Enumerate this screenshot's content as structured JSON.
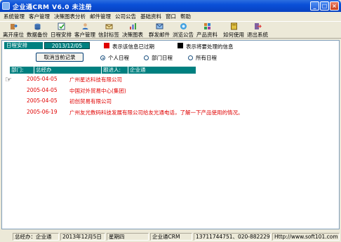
{
  "window": {
    "title": "企业通CRM V6.0   未注册"
  },
  "menu": [
    "系统管理",
    "客户管理",
    "决策图表分析",
    "邮件管理",
    "公司公告",
    "基础资料",
    "窗口",
    "帮助"
  ],
  "toolbar": [
    {
      "label": "离开座位",
      "icon": "exit-seat-icon"
    },
    {
      "label": "数据备份",
      "icon": "backup-icon"
    },
    {
      "label": "日程安排",
      "icon": "schedule-icon"
    },
    {
      "label": "客户管理",
      "icon": "customer-icon"
    },
    {
      "label": "信封标签",
      "icon": "envelope-icon"
    },
    {
      "label": "决策图表",
      "icon": "chart-icon"
    },
    {
      "label": "群发邮件",
      "icon": "mail-icon"
    },
    {
      "label": "浏览公告",
      "icon": "notice-icon"
    },
    {
      "label": "产品资料",
      "icon": "product-icon"
    },
    {
      "label": "如何使用",
      "icon": "help-book-icon"
    },
    {
      "label": "退出系统",
      "icon": "exit-icon"
    }
  ],
  "schedule": {
    "label": "日程安排",
    "date": "2013/12/05",
    "legend_expired": "表示该信息已过期",
    "legend_pending": "表示将要处理的信息",
    "cancel_button": "取消当前记录",
    "radio_personal": "个人日程",
    "radio_department": "部门日程",
    "radio_all": "所有日程",
    "selected": "个人日程"
  },
  "header": {
    "department_label": "部门:",
    "department_value": "总经办",
    "tracker_label": "跟进人:",
    "tracker_value": "企业通"
  },
  "records": [
    {
      "date": "2005-04-05",
      "text": "广州星达科技有限公司"
    },
    {
      "date": "2005-04-05",
      "text": "中国对外贸易中心(集团)"
    },
    {
      "date": "2005-04-05",
      "text": "初创贸易有限公司"
    },
    {
      "date": "2005-06-19",
      "text": "广州友光数码科技发展有限公司给友光通电话，了解一下产品使用的情况。"
    }
  ],
  "statusbar": [
    "总经办：企业通",
    "2013年12月5日",
    "星期四",
    "企业通CRM",
    "13711744751、020-88222967",
    "Http://www.soft101.com"
  ],
  "colors": {
    "teal": "#008080",
    "record_red": "#e00000",
    "titlebar_blue": "#0a4fd8"
  }
}
